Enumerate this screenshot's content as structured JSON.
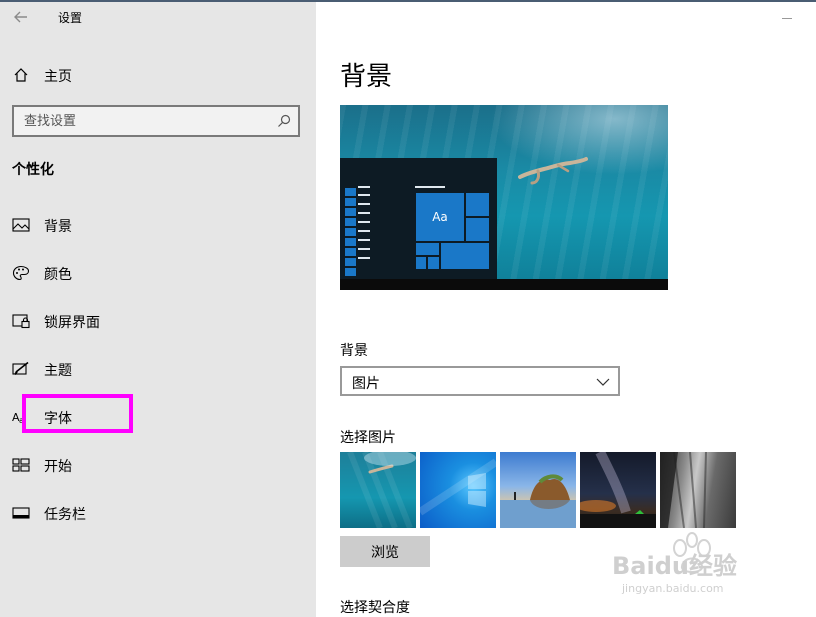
{
  "window": {
    "title": "设置"
  },
  "sidebar": {
    "home_label": "主页",
    "search_placeholder": "查找设置",
    "section_title": "个性化",
    "items": [
      {
        "label": "背景",
        "icon": "picture-icon"
      },
      {
        "label": "颜色",
        "icon": "palette-icon"
      },
      {
        "label": "锁屏界面",
        "icon": "lock-screen-icon"
      },
      {
        "label": "主题",
        "icon": "theme-brush-icon"
      },
      {
        "label": "字体",
        "icon": "font-icon"
      },
      {
        "label": "开始",
        "icon": "start-grid-icon"
      },
      {
        "label": "任务栏",
        "icon": "taskbar-icon"
      }
    ],
    "highlight_color": "#ff00ff"
  },
  "main": {
    "page_title": "背景",
    "preview_tile_label": "Aa",
    "background_label": "背景",
    "background_value": "图片",
    "choose_picture_label": "选择图片",
    "browse_label": "浏览",
    "fit_label": "选择契合度"
  },
  "watermark": {
    "brand": "Baidu经验",
    "url": "jingyan.baidu.com"
  },
  "colors": {
    "sidebar_bg": "#e6e6e6",
    "accent": "#1a78c8",
    "button_bg": "#cccccc"
  }
}
